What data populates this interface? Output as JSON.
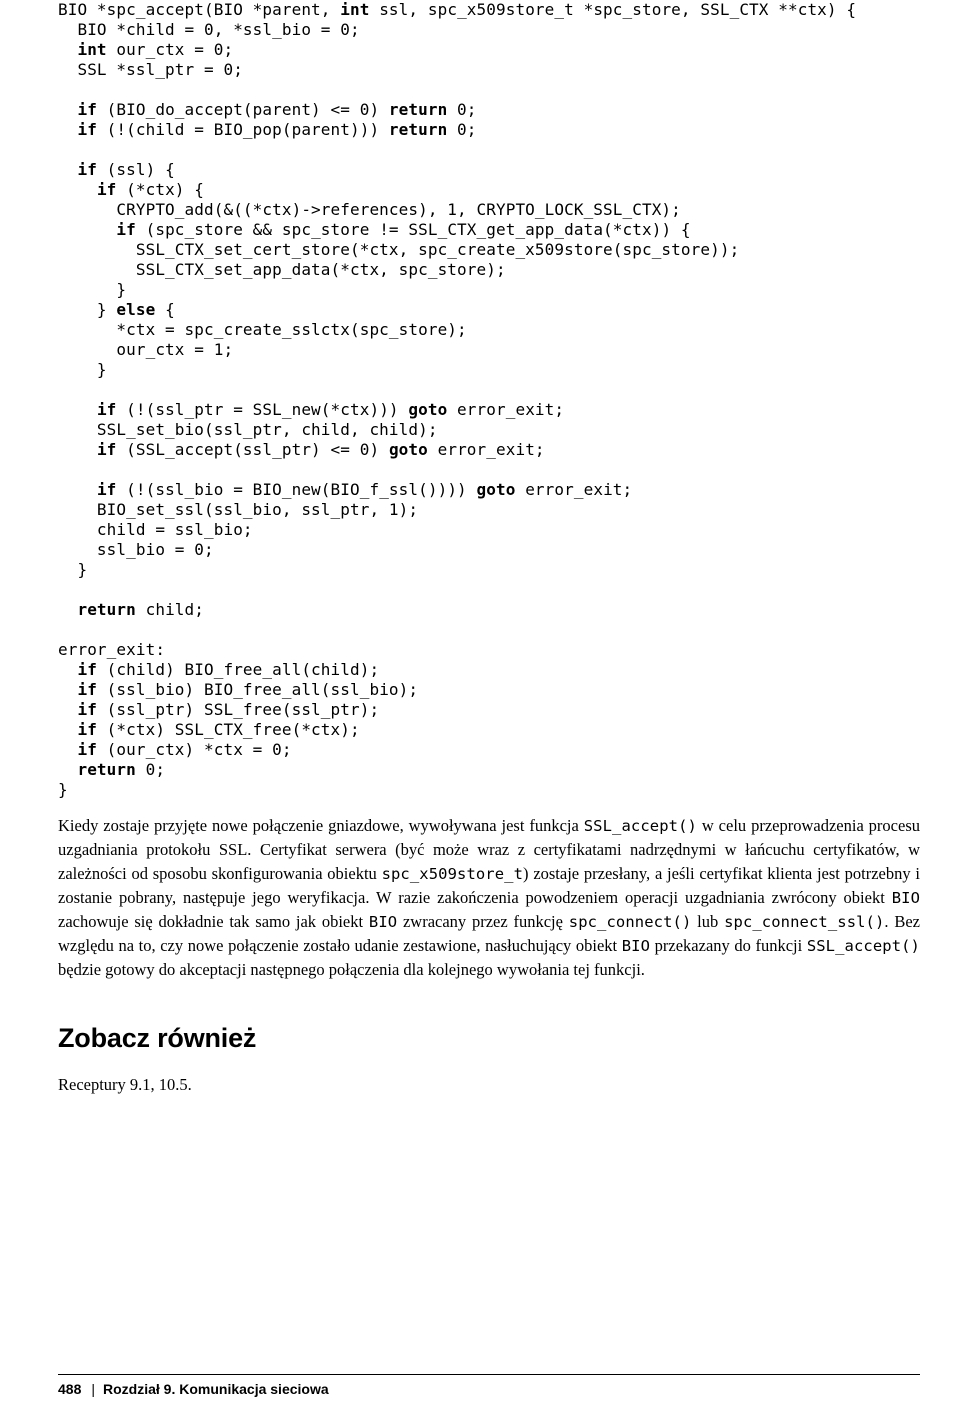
{
  "code": {
    "l01a": "BIO *spc_accept(BIO *parent, ",
    "l01b": "int",
    "l01c": " ssl, spc_x509store_t *spc_store, SSL_CTX **ctx) {",
    "l02": "  BIO *child = 0, *ssl_bio = 0;",
    "l03a": "  ",
    "l03b": "int",
    "l03c": " our_ctx = 0;",
    "l04": "  SSL *ssl_ptr = 0;",
    "blank1": "",
    "l05a": "  ",
    "l05b": "if",
    "l05c": " (BIO_do_accept(parent) <= 0) ",
    "l05d": "return",
    "l05e": " 0;",
    "l06a": "  ",
    "l06b": "if",
    "l06c": " (!(child = BIO_pop(parent))) ",
    "l06d": "return",
    "l06e": " 0;",
    "blank2": "",
    "l07a": "  ",
    "l07b": "if",
    "l07c": " (ssl) {",
    "l08a": "    ",
    "l08b": "if",
    "l08c": " (*ctx) {",
    "l09": "      CRYPTO_add(&((*ctx)->references), 1, CRYPTO_LOCK_SSL_CTX);",
    "l10a": "      ",
    "l10b": "if",
    "l10c": " (spc_store && spc_store != SSL_CTX_get_app_data(*ctx)) {",
    "l11": "        SSL_CTX_set_cert_store(*ctx, spc_create_x509store(spc_store));",
    "l12": "        SSL_CTX_set_app_data(*ctx, spc_store);",
    "l13": "      }",
    "l14a": "    } ",
    "l14b": "else",
    "l14c": " {",
    "l15": "      *ctx = spc_create_sslctx(spc_store);",
    "l16": "      our_ctx = 1;",
    "l17": "    }",
    "blank3": "",
    "l18a": "    ",
    "l18b": "if",
    "l18c": " (!(ssl_ptr = SSL_new(*ctx))) ",
    "l18d": "goto",
    "l18e": " error_exit;",
    "l19": "    SSL_set_bio(ssl_ptr, child, child);",
    "l20a": "    ",
    "l20b": "if",
    "l20c": " (SSL_accept(ssl_ptr) <= 0) ",
    "l20d": "goto",
    "l20e": " error_exit;",
    "blank4": "",
    "l21a": "    ",
    "l21b": "if",
    "l21c": " (!(ssl_bio = BIO_new(BIO_f_ssl()))) ",
    "l21d": "goto",
    "l21e": " error_exit;",
    "l22": "    BIO_set_ssl(ssl_bio, ssl_ptr, 1);",
    "l23": "    child = ssl_bio;",
    "l24": "    ssl_bio = 0;",
    "l25": "  }",
    "blank5": "",
    "l26a": "  ",
    "l26b": "return",
    "l26c": " child;",
    "blank6": "",
    "l27": "error_exit:",
    "l28a": "  ",
    "l28b": "if",
    "l28c": " (child) BIO_free_all(child);",
    "l29a": "  ",
    "l29b": "if",
    "l29c": " (ssl_bio) BIO_free_all(ssl_bio);",
    "l30a": "  ",
    "l30b": "if",
    "l30c": " (ssl_ptr) SSL_free(ssl_ptr);",
    "l31a": "  ",
    "l31b": "if",
    "l31c": " (*ctx) SSL_CTX_free(*ctx);",
    "l32a": "  ",
    "l32b": "if",
    "l32c": " (our_ctx) *ctx = 0;",
    "l33a": "  ",
    "l33b": "return",
    "l33c": " 0;",
    "l34": "}"
  },
  "para": {
    "p1": "Kiedy zostaje przyjęte nowe połączenie gniazdowe, wywoływana jest funkcja ",
    "c1": "SSL_accept()",
    "p2": " w celu przeprowadzenia procesu uzgadniania protokołu SSL. Certyfikat serwera (być może wraz z certyfikatami nadrzędnymi w łańcuchu certyfikatów, w zależności od sposobu skonfigurowania obiektu ",
    "c2": "spc_x509store_t",
    "p3": ") zostaje przesłany, a jeśli certyfikat klienta jest potrzebny i zostanie pobrany, następuje jego weryfikacja. W razie zakończenia powodzeniem operacji uzgadniania zwrócony obiekt ",
    "c3": "BIO",
    "p4": " zachowuje się dokładnie tak samo jak obiekt ",
    "c4": "BIO",
    "p5": " zwracany przez funkcję ",
    "c5": "spc_connect()",
    "p6": " lub ",
    "c6": "spc_connect_ssl()",
    "p7": ". Bez względu na to, czy nowe połączenie zostało udanie zestawione, nasłuchujący obiekt ",
    "c7": "BIO",
    "p8": " przekazany do funkcji ",
    "c8": "SSL_accept()",
    "p9": " będzie gotowy do akceptacji następnego połączenia dla kolejnego wywołania tej funkcji."
  },
  "see_also_heading": "Zobacz również",
  "recipes": "Receptury 9.1, 10.5.",
  "footer": {
    "page": "488",
    "sep": "|",
    "chapter": "Rozdział 9. Komunikacja sieciowa"
  }
}
